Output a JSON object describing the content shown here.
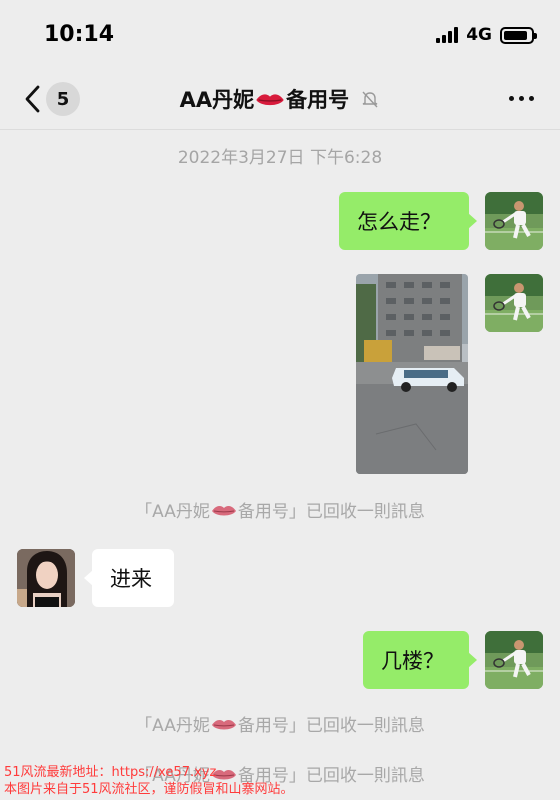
{
  "status_bar": {
    "time": "10:14",
    "network": "4G",
    "signal_icon": "signal-bars-icon",
    "battery_icon": "battery-icon"
  },
  "nav": {
    "back_icon": "chevron-left-icon",
    "unread_count": "5",
    "title_prefix": "AA丹妮",
    "title_suffix": "备用号",
    "mute_icon": "bell-muted-icon",
    "more_icon": "more-dots-icon"
  },
  "chat": {
    "timestamp": "2022年3月27日 下午6:28",
    "messages": [
      {
        "side": "self",
        "type": "text",
        "text": "怎么走？"
      },
      {
        "side": "self",
        "type": "image",
        "description": "street-photo"
      },
      {
        "side": "other",
        "type": "text",
        "text": "进来"
      },
      {
        "side": "self",
        "type": "text",
        "text": "几楼？"
      }
    ],
    "recall_notice": {
      "prefix": "「AA丹妮",
      "suffix": "备用号」已回收一則訊息"
    }
  },
  "watermark": {
    "line1": "51风流最新地址：https://xe57.xyz",
    "line2": "本图片来自于51风流社区，谨防假冒和山寨网站。"
  },
  "colors": {
    "background": "#ededed",
    "self_bubble": "#95ec69",
    "other_bubble": "#ffffff",
    "system_text": "#a8a8a8",
    "watermark": "#ff3b3b"
  }
}
